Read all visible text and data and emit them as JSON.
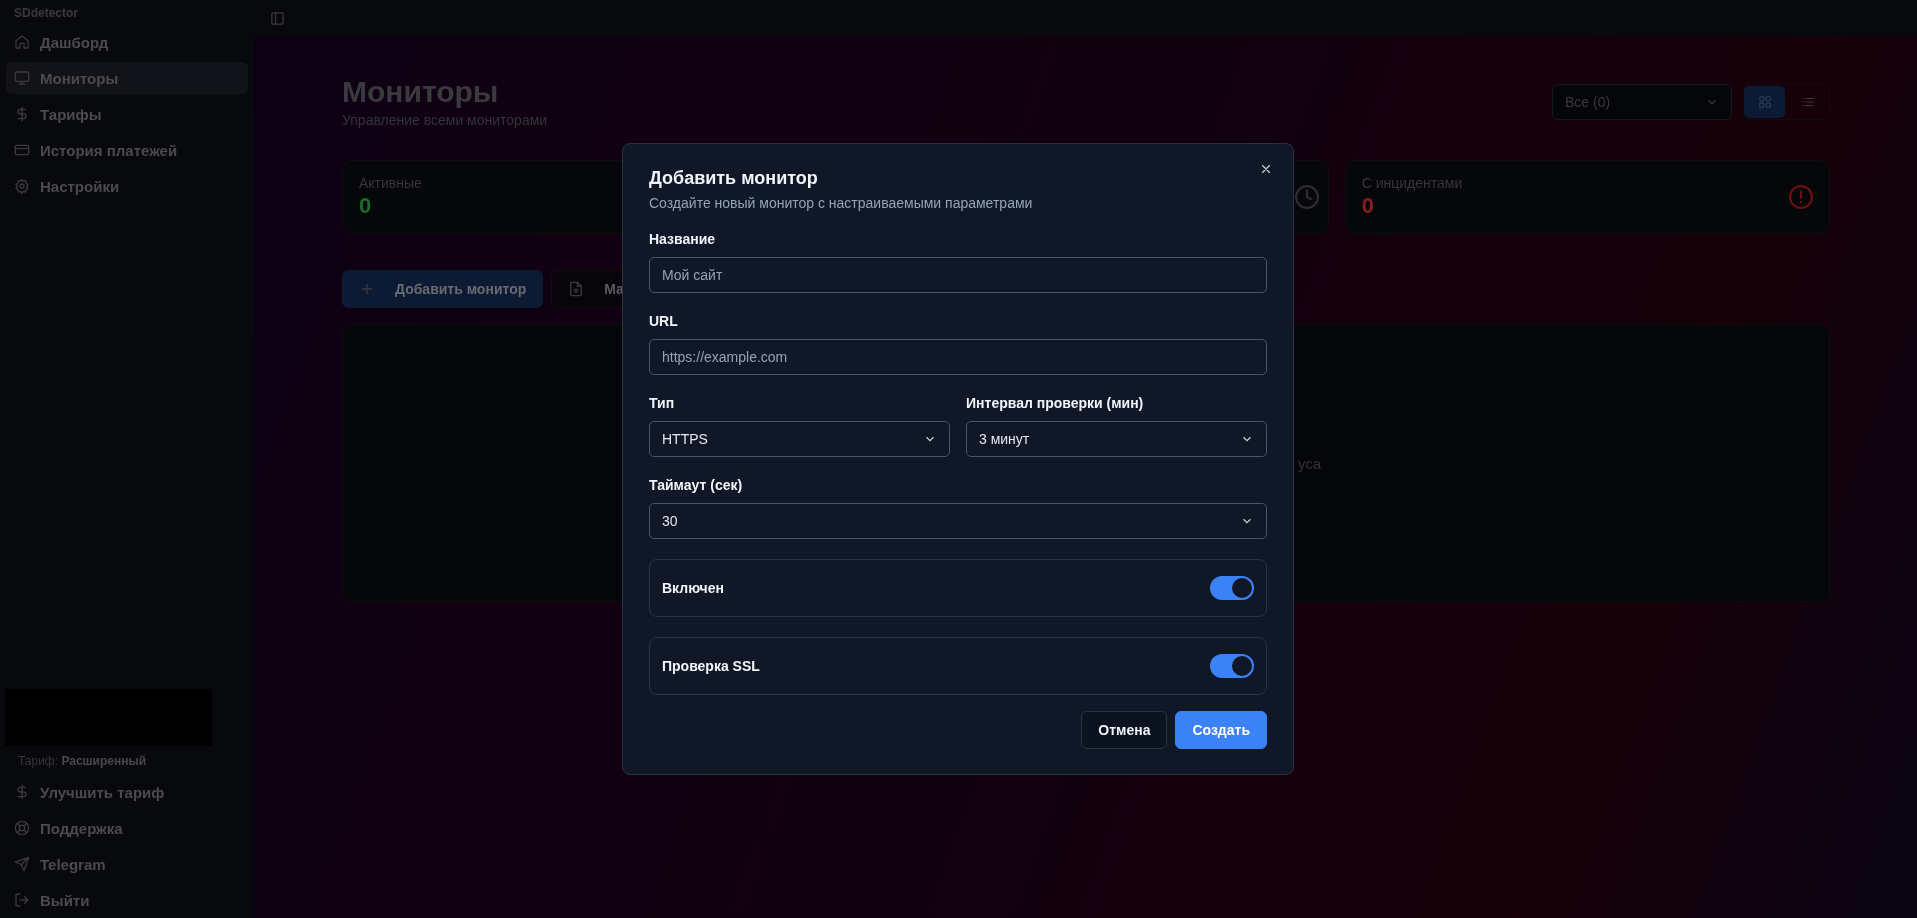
{
  "sidebar": {
    "brand": "SDdetector",
    "items": [
      {
        "label": "Дашборд",
        "selected": false
      },
      {
        "label": "Мониторы",
        "selected": true
      },
      {
        "label": "Тарифы",
        "selected": false
      },
      {
        "label": "История платежей",
        "selected": false
      },
      {
        "label": "Настройки",
        "selected": false
      }
    ],
    "plan": "Тариф: **Расширенный**",
    "footer_items": [
      {
        "label": "Улучшить тариф"
      },
      {
        "label": "Поддержка"
      },
      {
        "label": "Telegram"
      },
      {
        "label": "Выйти"
      }
    ]
  },
  "page": {
    "title": "Мониторы",
    "subtitle": "Управление всеми мониторами",
    "filter": "Все (0)",
    "view_toggle": [
      {
        "selected": true
      },
      {
        "selected": false
      }
    ],
    "stats": [
      {
        "label": "Активные",
        "value": "0",
        "color": "#1c6b2c"
      },
      {
        "kind": "covered"
      },
      {
        "label": "С инцидентами",
        "value": "0",
        "color": "#8a1c1c"
      }
    ],
    "actions": [
      {
        "label": "Добавить монитор",
        "kind": "primary"
      },
      {
        "label": "Ма",
        "kind": "secondary"
      }
    ],
    "empty_text": "уса"
  },
  "dialog": {
    "title": "Добавить монитор",
    "subtitle": "Создайте новый монитор с настраиваемыми параметрами",
    "fields": [
      {
        "label": "Название",
        "kind": "input",
        "placeholder": "Мой сайт"
      },
      {
        "label": "URL",
        "kind": "input",
        "placeholder": "https://example.com"
      },
      {
        "label": "Тип",
        "kind": "select_half",
        "value": "HTTPS"
      },
      {
        "label": "Интервал проверки (мин)",
        "kind": "select_half",
        "value": "3 минут"
      },
      {
        "label": "Таймаут (сек)",
        "kind": "select",
        "value": "30"
      },
      {
        "label": "Включен",
        "kind": "toggle",
        "on": true
      },
      {
        "label": "Проверка SSL",
        "kind": "toggle",
        "on": true
      }
    ],
    "buttons": [
      {
        "label": "Отмена",
        "kind": "secondary"
      },
      {
        "label": "Создать",
        "kind": "primary"
      }
    ]
  }
}
